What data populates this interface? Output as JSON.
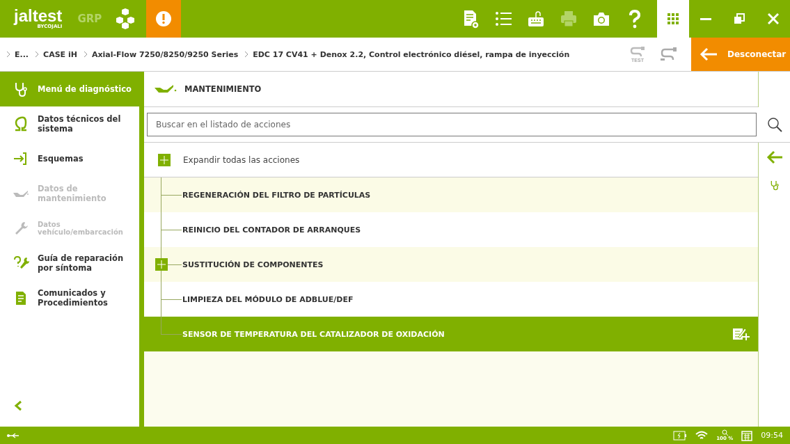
{
  "app": {
    "logo": "jaltest",
    "logo_sub": "BYCOJALI",
    "group": "GRP",
    "clock": "09:54",
    "zoom": "100 %"
  },
  "toolbar": [
    {
      "kind": "doc",
      "disabled": false
    },
    {
      "kind": "list",
      "disabled": false
    },
    {
      "kind": "keyboard",
      "disabled": false
    },
    {
      "kind": "printer",
      "disabled": true
    },
    {
      "kind": "camera",
      "disabled": false
    },
    {
      "kind": "help",
      "disabled": false
    }
  ],
  "breadcrumb": [
    "E...",
    "CASE iH",
    "Axial-Flow 7250/8250/9250 Series",
    "EDC 17 CV41 + Denox 2.2, Control electrónico diésel, rampa de inyección"
  ],
  "test_label": "TEST",
  "disconnect": "Desconectar",
  "sidebar": [
    {
      "label": "Menú de diagnóstico",
      "kind": "stethoscope",
      "selected": true,
      "disabled": false
    },
    {
      "label": "Datos técnicos del sistema",
      "kind": "omega",
      "selected": false,
      "disabled": false
    },
    {
      "label": "Esquemas",
      "kind": "schema",
      "selected": false,
      "disabled": false
    },
    {
      "label": "Datos de mantenimiento",
      "kind": "oilcan",
      "selected": false,
      "disabled": true
    },
    {
      "label": "Datos vehículo/embarcación",
      "kind": "wrench",
      "selected": false,
      "disabled": true
    },
    {
      "label": "Guía de reparación por síntoma",
      "kind": "repair",
      "selected": false,
      "disabled": false
    },
    {
      "label": "Comunicados y Procedimientos",
      "kind": "document",
      "selected": false,
      "disabled": false
    }
  ],
  "section_title": "MANTENIMIENTO",
  "search": {
    "placeholder": "Buscar en el listado de acciones"
  },
  "expand_all": "Expandir todas las acciones",
  "actions": [
    {
      "label": "REGENERACIÓN DEL FILTRO DE PARTÍCULAS",
      "expandable": false,
      "selected": false
    },
    {
      "label": "REINICIO DEL CONTADOR DE ARRANQUES",
      "expandable": false,
      "selected": false
    },
    {
      "label": "SUSTITUCIÓN DE COMPONENTES",
      "expandable": true,
      "selected": false
    },
    {
      "label": "LIMPIEZA DEL MÓDULO DE ADBLUE/DEF",
      "expandable": false,
      "selected": false
    },
    {
      "label": "SENSOR DE TEMPERATURA DEL CATALIZADOR DE OXIDACIÓN",
      "expandable": false,
      "selected": true
    }
  ]
}
